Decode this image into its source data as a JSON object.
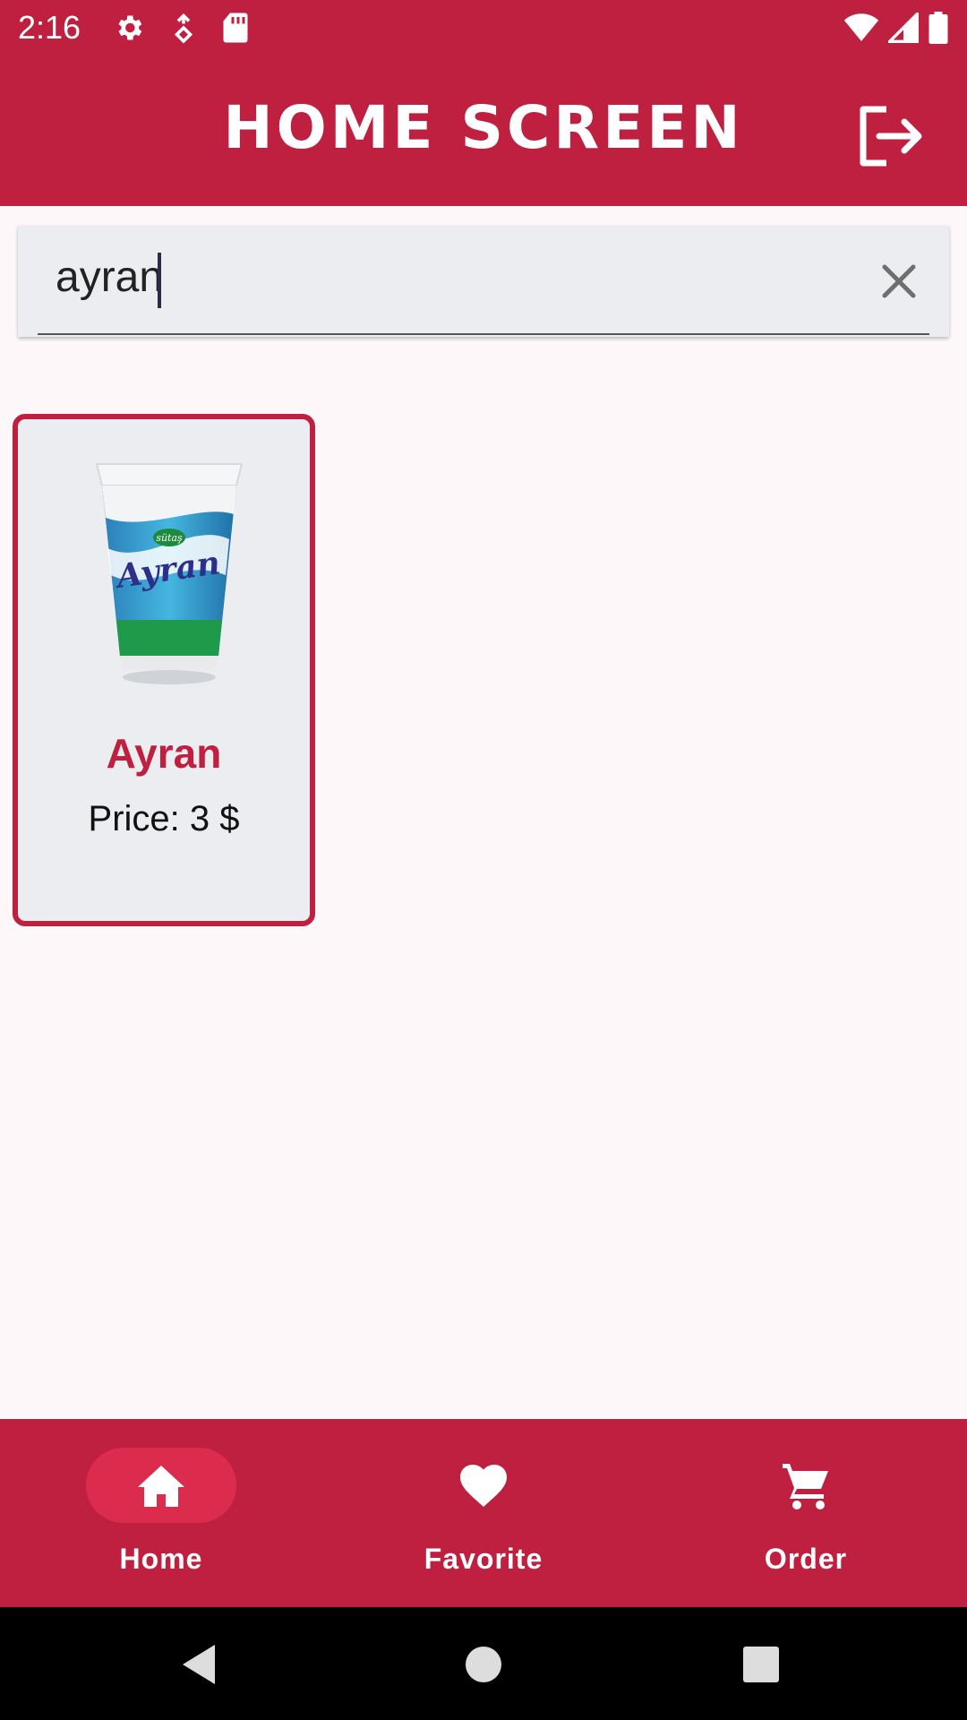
{
  "status_bar": {
    "time": "2:16",
    "icons_left": [
      "settings-icon",
      "location-icon",
      "sd-card-icon"
    ],
    "icons_right": [
      "wifi-icon",
      "signal-icon",
      "battery-icon"
    ]
  },
  "app_bar": {
    "title": "HOME SCREEN",
    "logout_icon": "logout-icon"
  },
  "search": {
    "value": "ayran",
    "clear_icon": "close-icon"
  },
  "products": [
    {
      "name": "Ayran",
      "price": "Price: 3 $",
      "image_brand": "sütaş",
      "image_label": "Ayran"
    }
  ],
  "bottom_nav": {
    "items": [
      {
        "label": "Home",
        "icon": "home-icon",
        "active": true
      },
      {
        "label": "Favorite",
        "icon": "heart-icon",
        "active": false
      },
      {
        "label": "Order",
        "icon": "cart-icon",
        "active": false
      }
    ]
  },
  "system_nav": [
    "back-icon",
    "home-circle-icon",
    "recents-icon"
  ],
  "colors": {
    "primary": "#bf2040",
    "active_pill": "#dc2c4e",
    "card_bg": "#ebedf0",
    "page_bg": "#fef7fa"
  }
}
